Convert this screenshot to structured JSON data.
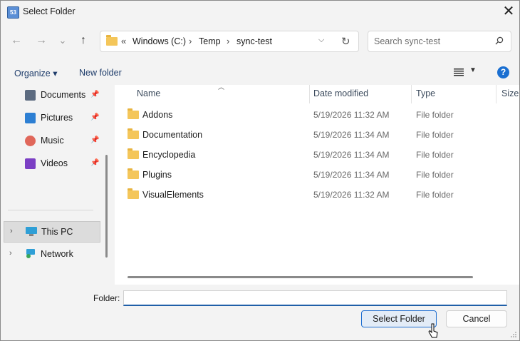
{
  "window": {
    "title": "Select Folder",
    "app_icon_text": "53"
  },
  "nav": {
    "back": "←",
    "forward": "→",
    "recent": "⌄",
    "up": "↑",
    "address": {
      "overflow": "«",
      "segments": [
        "Windows (C:)",
        "Temp",
        "sync-test"
      ],
      "separator": "›"
    },
    "refresh": "↻",
    "search_placeholder": "Search sync-test"
  },
  "toolbar": {
    "organize": "Organize ▾",
    "new_folder": "New folder",
    "help": "?"
  },
  "sidebar": {
    "quick": [
      {
        "label": "Documents",
        "icon": "documents-icon",
        "color": "#5c6b80"
      },
      {
        "label": "Pictures",
        "icon": "pictures-icon",
        "color": "#2d7fd3"
      },
      {
        "label": "Music",
        "icon": "music-icon",
        "color": "#e0675a"
      },
      {
        "label": "Videos",
        "icon": "videos-icon",
        "color": "#7b3fc4"
      }
    ],
    "tree": [
      {
        "label": "This PC",
        "selected": true
      },
      {
        "label": "Network",
        "selected": false
      }
    ]
  },
  "columns": {
    "name": "Name",
    "date": "Date modified",
    "type": "Type",
    "size": "Size"
  },
  "files": [
    {
      "name": "Addons",
      "date": "5/19/2026 11:32 AM",
      "type": "File folder"
    },
    {
      "name": "Documentation",
      "date": "5/19/2026 11:34 AM",
      "type": "File folder"
    },
    {
      "name": "Encyclopedia",
      "date": "5/19/2026 11:34 AM",
      "type": "File folder"
    },
    {
      "name": "Plugins",
      "date": "5/19/2026 11:34 AM",
      "type": "File folder"
    },
    {
      "name": "VisualElements",
      "date": "5/19/2026 11:32 AM",
      "type": "File folder"
    }
  ],
  "footer": {
    "folder_label": "Folder:",
    "folder_value": "",
    "select_button": "Select Folder",
    "cancel_button": "Cancel"
  }
}
